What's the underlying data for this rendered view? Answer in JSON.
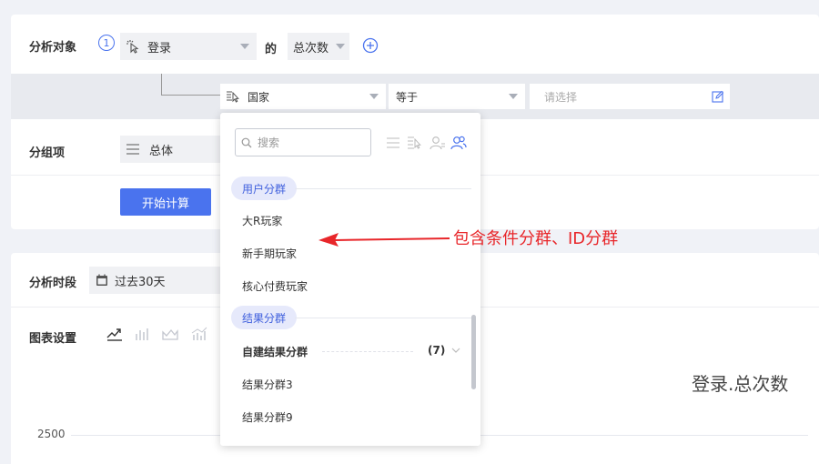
{
  "target": {
    "label": "分析对象",
    "step": "1",
    "event": "登录",
    "of": "的",
    "metric": "总次数"
  },
  "filter": {
    "property": "国家",
    "operator": "等于",
    "value_placeholder": "请选择"
  },
  "group": {
    "label": "分组项",
    "value": "总体"
  },
  "compute_button": "开始计算",
  "period": {
    "label": "分析时段",
    "value": "过去30天"
  },
  "chart_settings_label": "图表设置",
  "chart_title": "登录.总次数",
  "y_tick": "2500",
  "dropdown": {
    "search_placeholder": "搜索",
    "groups": [
      {
        "name": "用户分群",
        "items": [
          "大R玩家",
          "新手期玩家",
          "核心付费玩家"
        ]
      },
      {
        "name": "结果分群",
        "subgroup": {
          "name": "自建结果分群",
          "count": "(7)"
        },
        "items": [
          "结果分群3",
          "结果分群9"
        ]
      }
    ]
  },
  "annotation": "包含条件分群、ID分群",
  "colors": {
    "accent": "#4a73ee",
    "annotation": "#e8262a"
  }
}
